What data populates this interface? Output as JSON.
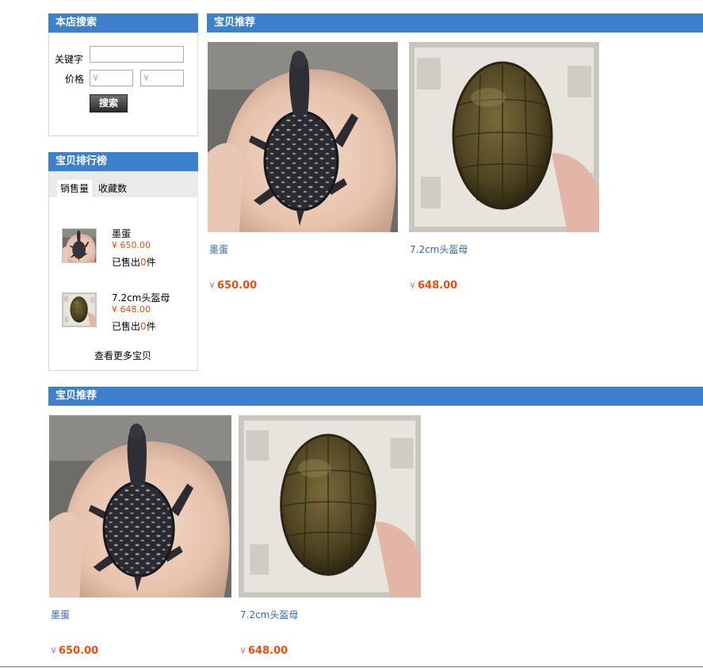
{
  "search": {
    "title": "本店搜索",
    "keyword_label": "关键字",
    "price_label": "价格",
    "price_min_placeholder": "¥",
    "price_max_placeholder": "¥",
    "button": "搜索"
  },
  "ranking": {
    "title": "宝贝排行榜",
    "tabs": [
      {
        "label": "销售量",
        "active": true
      },
      {
        "label": "收藏数",
        "active": false
      }
    ],
    "items": [
      {
        "name": "墨蛋",
        "price": "¥ 650.00",
        "sold_prefix": "已售出",
        "sold_count": "0",
        "sold_suffix": "件"
      },
      {
        "name": "7.2cm头盔母",
        "price": "¥ 648.00",
        "sold_prefix": "已售出",
        "sold_count": "0",
        "sold_suffix": "件"
      }
    ],
    "more": "查看更多宝贝"
  },
  "recommend_top": {
    "title": "宝贝推荐",
    "products": [
      {
        "name": "墨蛋",
        "currency": "¥",
        "price": "650.00",
        "image": "dark-spotted-turtle"
      },
      {
        "name": "7.2cm头盔母",
        "currency": "¥",
        "price": "648.00",
        "image": "olive-shell-turtle"
      }
    ]
  },
  "recommend_bottom": {
    "title": "宝贝推荐",
    "products": [
      {
        "name": "墨蛋",
        "currency": "¥",
        "price": "650.00",
        "image": "dark-spotted-turtle"
      },
      {
        "name": "7.2cm头盔母",
        "currency": "¥",
        "price": "648.00",
        "image": "olive-shell-turtle"
      }
    ]
  },
  "colors": {
    "title_bar": "#3d80cc",
    "price": "#f04b0f",
    "link": "#3366aa"
  }
}
